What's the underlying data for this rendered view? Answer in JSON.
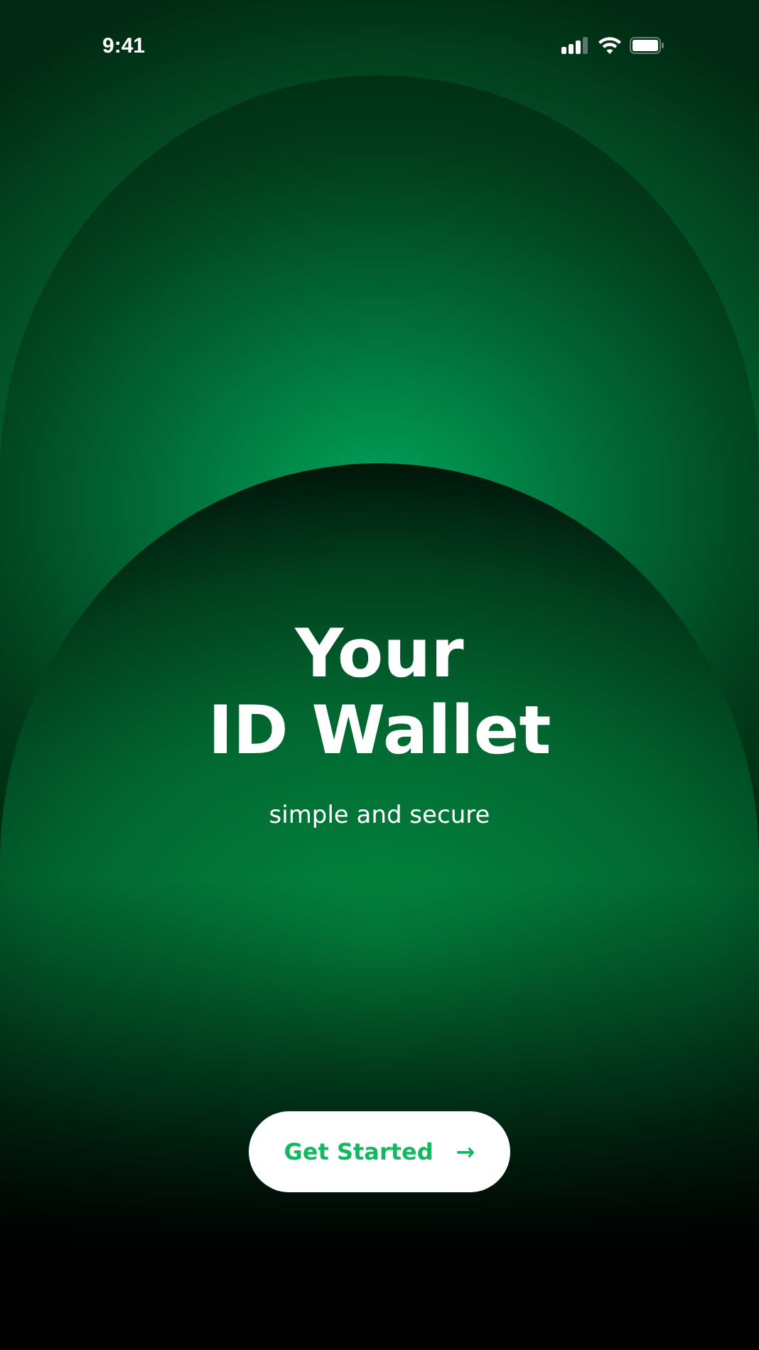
{
  "status_bar": {
    "time": "9:41"
  },
  "hero": {
    "title_lines": [
      "Your",
      "ID Wallet"
    ],
    "subtitle": "simple and secure"
  },
  "cta": {
    "label": "Get Started",
    "icon": "→"
  }
}
